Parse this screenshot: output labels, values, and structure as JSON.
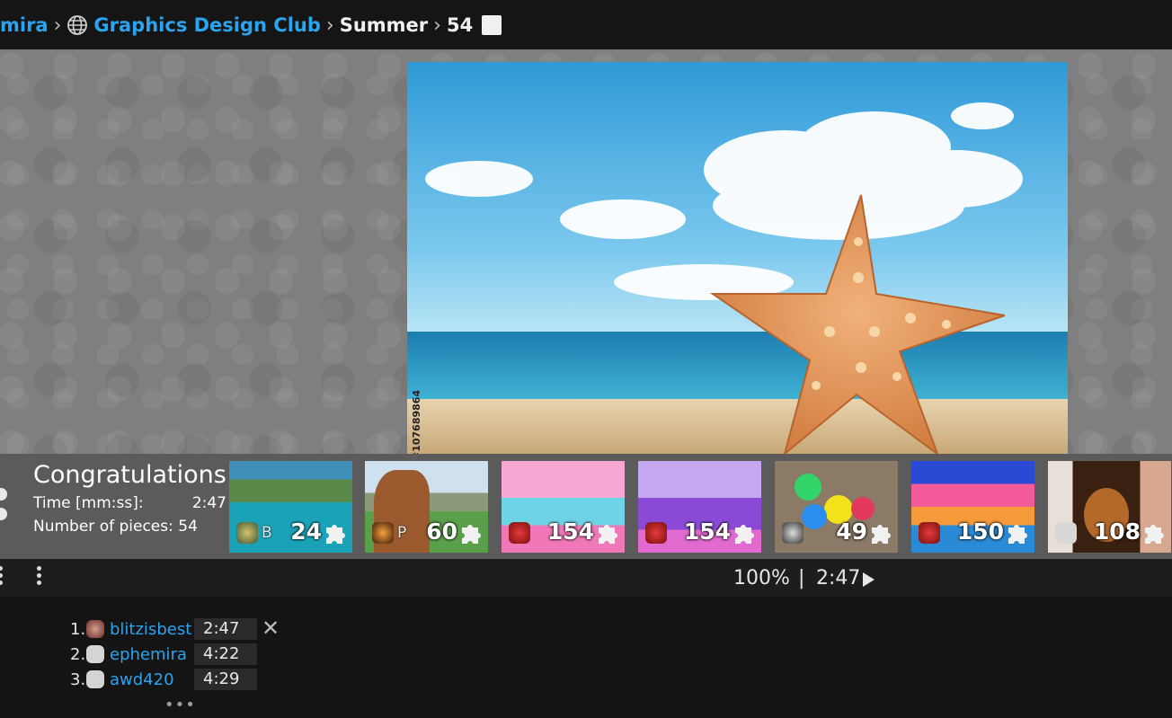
{
  "breadcrumb": {
    "user": "mira",
    "club": "Graphics Design Club",
    "category": "Summer",
    "pieces": "54"
  },
  "puzzle": {
    "stock_id": "#107689864"
  },
  "congrats": {
    "title": "Congratulations!",
    "time_label": "Time [mm:ss]:",
    "time_value": "2:47",
    "pieces_label": "Number of pieces: 54"
  },
  "thumbnails": [
    {
      "count": "24",
      "badge": "B"
    },
    {
      "count": "60",
      "badge": "P"
    },
    {
      "count": "154",
      "badge": ""
    },
    {
      "count": "154",
      "badge": ""
    },
    {
      "count": "49",
      "badge": ""
    },
    {
      "count": "150",
      "badge": ""
    },
    {
      "count": "108",
      "badge": ""
    }
  ],
  "statusbar": {
    "zoom": "100%",
    "separator": "|",
    "timer": "2:47"
  },
  "leaderboard": [
    {
      "rank": "1.",
      "name": "blitzisbest",
      "time": "2:47"
    },
    {
      "rank": "2.",
      "name": "ephemira",
      "time": "4:22"
    },
    {
      "rank": "3.",
      "name": "awd420",
      "time": "4:29"
    }
  ],
  "leaderboard_more": "•••",
  "colors": {
    "link": "#2aa4ee",
    "header_bg": "#151515",
    "board_bg": "#7f7f7f",
    "strip_bg": "#5b5b5b"
  }
}
